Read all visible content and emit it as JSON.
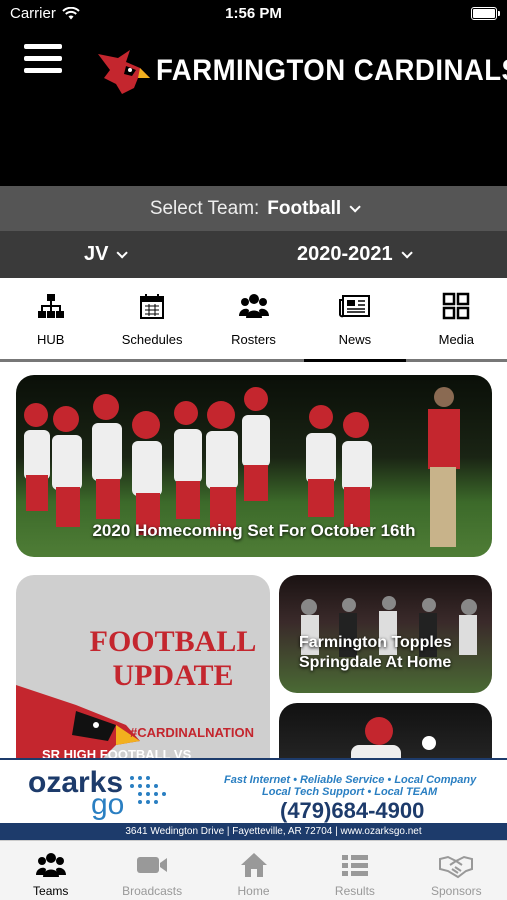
{
  "status_bar": {
    "carrier": "Carrier",
    "time": "1:56 PM"
  },
  "header": {
    "title": "FARMINGTON CARDINALS",
    "logo_icon": "cardinal-logo"
  },
  "team_select": {
    "label": "Select Team:",
    "value": "Football"
  },
  "filters": {
    "level": "JV",
    "season": "2020-2021"
  },
  "subnav": [
    {
      "label": "HUB",
      "icon": "sitemap-icon"
    },
    {
      "label": "Schedules",
      "icon": "calendar-icon"
    },
    {
      "label": "Rosters",
      "icon": "users-icon"
    },
    {
      "label": "News",
      "icon": "newspaper-icon"
    },
    {
      "label": "Media",
      "icon": "grid-icon"
    }
  ],
  "subnav_active": "News",
  "news": [
    {
      "caption": "2020 Homecoming Set For October 16th"
    },
    {
      "headline": "FOOTBALL UPDATE",
      "headline_line1": "FOOTBALL",
      "headline_line2": "UPDATE",
      "hashtag": "#CARDINALNATION",
      "subtitle": "SR HIGH FOOTBALL VS"
    },
    {
      "caption_line1": "Farmington Topples",
      "caption_line2": "Springdale At Home"
    },
    {
      "caption": ""
    }
  ],
  "ad": {
    "brand_line1": "ozarks",
    "brand_line2": "go",
    "tagline1": "Fast Internet • Reliable Service • Local Company",
    "tagline2": "Local Tech Support • Local TEAM",
    "phone": "(479)684-4900",
    "address": "3641 Wedington Drive  |  Fayetteville, AR 72704  |  www.ozarksgo.net"
  },
  "tabbar": [
    {
      "label": "Teams",
      "icon": "users-icon"
    },
    {
      "label": "Broadcasts",
      "icon": "video-camera-icon"
    },
    {
      "label": "Home",
      "icon": "home-icon"
    },
    {
      "label": "Results",
      "icon": "list-icon"
    },
    {
      "label": "Sponsors",
      "icon": "handshake-icon"
    }
  ],
  "tabbar_active": "Teams",
  "colors": {
    "brand_red": "#c4262e",
    "ad_navy": "#1d3b6b",
    "ad_blue": "#2a7fc2"
  }
}
